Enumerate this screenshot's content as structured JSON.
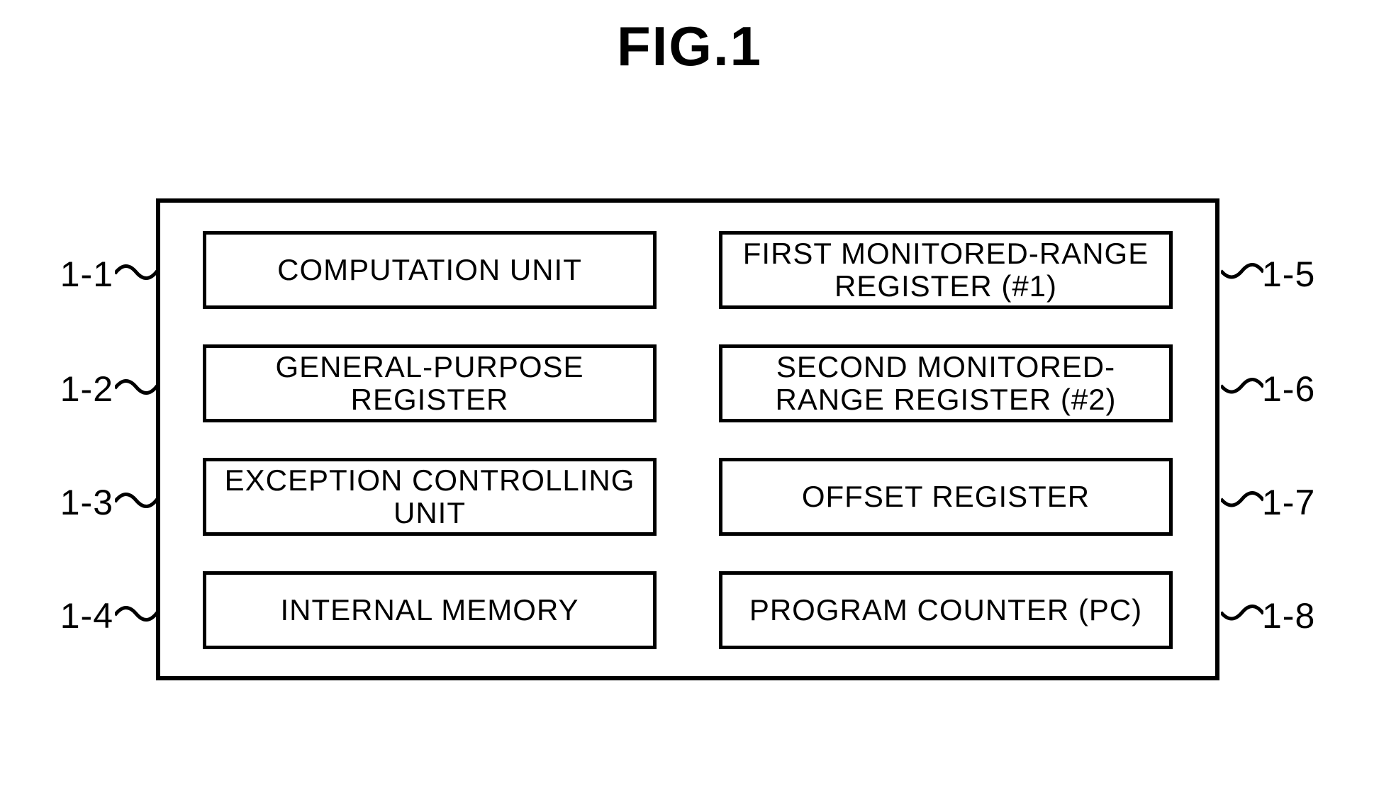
{
  "figure_title": "FIG.1",
  "left_blocks": {
    "b1": {
      "ref": "1-1",
      "label": "COMPUTATION UNIT"
    },
    "b2": {
      "ref": "1-2",
      "label": "GENERAL-PURPOSE REGISTER"
    },
    "b3": {
      "ref": "1-3",
      "label": "EXCEPTION CONTROLLING UNIT"
    },
    "b4": {
      "ref": "1-4",
      "label": "INTERNAL MEMORY"
    }
  },
  "right_blocks": {
    "b1": {
      "ref": "1-5",
      "label": "FIRST MONITORED-RANGE REGISTER (#1)"
    },
    "b2": {
      "ref": "1-6",
      "label": "SECOND MONITORED-RANGE REGISTER (#2)"
    },
    "b3": {
      "ref": "1-7",
      "label": "OFFSET REGISTER"
    },
    "b4": {
      "ref": "1-8",
      "label": "PROGRAM COUNTER (PC)"
    }
  }
}
